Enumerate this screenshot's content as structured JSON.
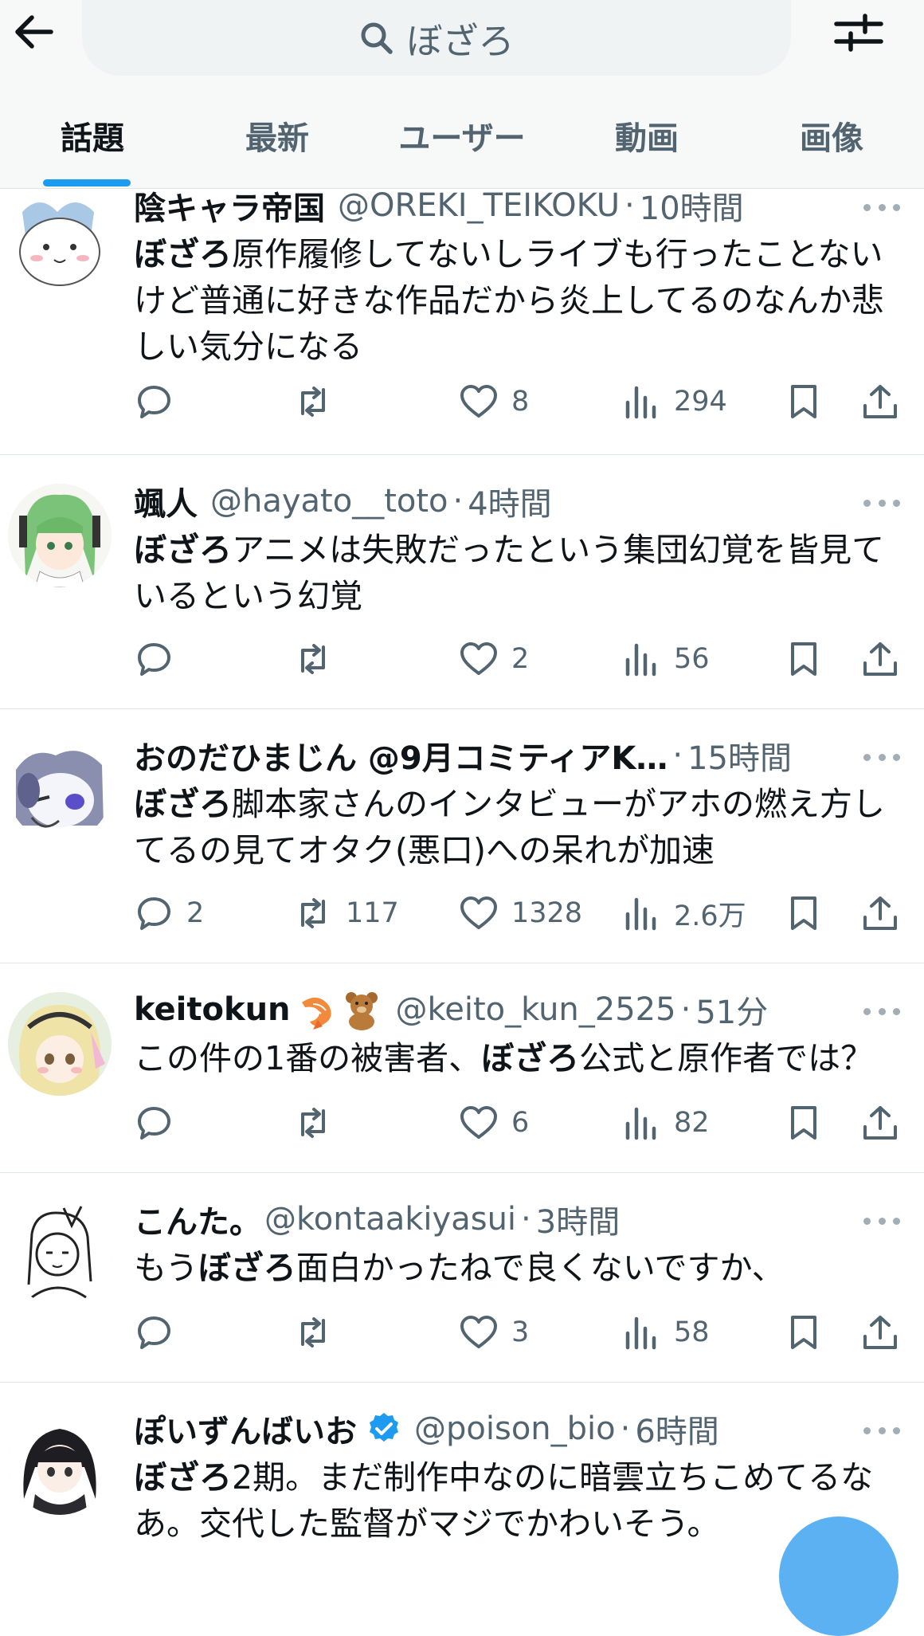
{
  "search": {
    "query": "ぼざろ"
  },
  "tabs": [
    "話題",
    "最新",
    "ユーザー",
    "動画",
    "画像"
  ],
  "tweets": [
    {
      "name": "陰キャラ帝国",
      "handle": "@OREKI_TEIKOKU",
      "time": "10時間",
      "highlight": "ぼざろ",
      "text": "原作履修してないしライブも行ったことないけど普通に好きな作品だから炎上してるのなんか悲しい気分になる",
      "replies": "",
      "retweets": "",
      "likes": "8",
      "views": "294"
    },
    {
      "name": "颯人",
      "handle": "@hayato__toto",
      "time": "4時間",
      "highlight": "ぼざろ",
      "text": "アニメは失敗だったという集団幻覚を皆見ているという幻覚",
      "replies": "",
      "retweets": "",
      "likes": "2",
      "views": "56"
    },
    {
      "name": "おのだひまじん @9月コミティアK…",
      "handle": "",
      "time": "15時間",
      "highlight": "ぼざろ",
      "text": "脚本家さんのインタビューがアホの燃え方してるの見てオタク(悪口)への呆れが加速",
      "replies": "2",
      "retweets": "117",
      "likes": "1328",
      "views": "2.6万"
    },
    {
      "name": "keitokun",
      "handle": "@keito_kun_2525",
      "time": "51分",
      "pre_text": "この件の1番の被害者、",
      "highlight": "ぼざろ",
      "text": "公式と原作者では？",
      "replies": "",
      "retweets": "",
      "likes": "6",
      "views": "82"
    },
    {
      "name": "こんた。",
      "handle": "@kontaakiyasui",
      "time": "3時間",
      "pre_text": "もう",
      "highlight": "ぼざろ",
      "text": "面白かったねで良くないですか、",
      "replies": "",
      "retweets": "",
      "likes": "3",
      "views": "58"
    },
    {
      "name": "ぽいずんばいお",
      "handle": "@poison_bio",
      "time": "6時間",
      "highlight": "ぼざろ",
      "text": "2期。まだ制作中なのに暗雲立ちこめてるなあ。交代した監督がマジでかわいそう。",
      "replies": "",
      "retweets": "",
      "likes": "",
      "views": ""
    }
  ],
  "icons": {
    "back": "arrow-left-icon",
    "search": "search-icon",
    "filter": "sliders-icon",
    "reply": "reply-icon",
    "retweet": "retweet-icon",
    "like": "heart-icon",
    "views": "views-icon",
    "bookmark": "bookmark-icon",
    "share": "share-icon",
    "more": "more-icon"
  },
  "colors": {
    "accent": "#1d9bf0",
    "text": "#0f1419",
    "muted": "#536471"
  }
}
